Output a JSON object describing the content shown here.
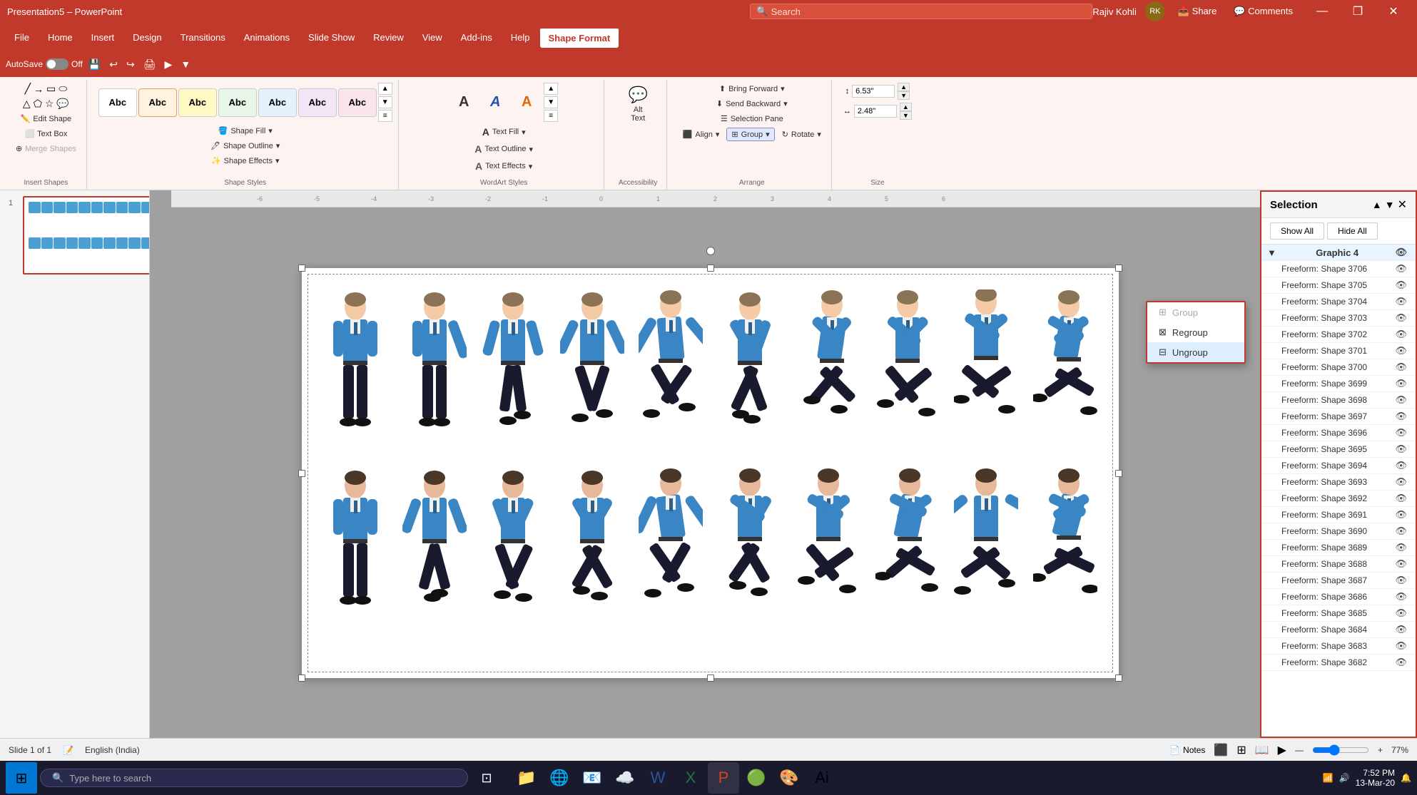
{
  "titlebar": {
    "filename": "Presentation5 – PowerPoint",
    "search_placeholder": "Search",
    "username": "Rajiv Kohli",
    "minimize": "—",
    "restore": "❐",
    "close": "✕"
  },
  "menu": {
    "items": [
      "File",
      "Home",
      "Insert",
      "Design",
      "Transitions",
      "Animations",
      "Slide Show",
      "Review",
      "View",
      "Add-ins",
      "Help",
      "Shape Format"
    ],
    "active": "Shape Format"
  },
  "quickaccess": {
    "autosave_label": "AutoSave",
    "off_label": "Off"
  },
  "ribbon": {
    "insert_shapes_label": "Insert Shapes",
    "shape_styles_label": "Shape Styles",
    "wordart_label": "WordArt Styles",
    "accessibility_label": "Accessibility",
    "arrange_label": "Arrange",
    "size_label": "Size",
    "edit_shape": "Edit Shape",
    "text_box": "Text Box",
    "merge_shapes": "Merge Shapes",
    "shape_fill": "Shape Fill",
    "shape_outline": "Shape Outline",
    "shape_effects": "Shape Effects",
    "text_fill": "Text Fill",
    "text_outline": "Text Outline",
    "text_effects": "Text Effects",
    "alt_text": "Alt\nText",
    "bring_forward": "Bring Forward",
    "send_backward": "Send Backward",
    "selection_pane": "Selection Pane",
    "align": "Align",
    "group": "Group",
    "rotate": "Rotate",
    "width": "6.53\"",
    "height": "2.48\"",
    "shape_styles": [
      {
        "bg": "#ffffff",
        "border": "#ccc",
        "text_color": "#333"
      },
      {
        "bg": "#ffe0b2",
        "border": "#ccc",
        "text_color": "#333"
      },
      {
        "bg": "#fff9c4",
        "border": "#ccc",
        "text_color": "#333"
      },
      {
        "bg": "#c8e6c9",
        "border": "#ccc",
        "text_color": "#333"
      },
      {
        "bg": "#bbdefb",
        "border": "#ccc",
        "text_color": "#333"
      },
      {
        "bg": "#e1bee7",
        "border": "#ccc",
        "text_color": "#333"
      },
      {
        "bg": "#f8bbd0",
        "border": "#ccc",
        "text_color": "#333"
      }
    ]
  },
  "group_dropdown": {
    "group_label": "Group",
    "regroup_label": "Regroup",
    "ungroup_label": "Ungroup"
  },
  "selection_pane": {
    "title": "Selection",
    "show_all": "Show All",
    "hide_all": "Hide All",
    "items": [
      {
        "name": "Graphic 4",
        "is_group": true
      },
      {
        "name": "Freeform: Shape 3706",
        "is_group": false
      },
      {
        "name": "Freeform: Shape 3705",
        "is_group": false
      },
      {
        "name": "Freeform: Shape 3704",
        "is_group": false
      },
      {
        "name": "Freeform: Shape 3703",
        "is_group": false
      },
      {
        "name": "Freeform: Shape 3702",
        "is_group": false
      },
      {
        "name": "Freeform: Shape 3701",
        "is_group": false
      },
      {
        "name": "Freeform: Shape 3700",
        "is_group": false
      },
      {
        "name": "Freeform: Shape 3699",
        "is_group": false
      },
      {
        "name": "Freeform: Shape 3698",
        "is_group": false
      },
      {
        "name": "Freeform: Shape 3697",
        "is_group": false
      },
      {
        "name": "Freeform: Shape 3696",
        "is_group": false
      },
      {
        "name": "Freeform: Shape 3695",
        "is_group": false
      },
      {
        "name": "Freeform: Shape 3694",
        "is_group": false
      },
      {
        "name": "Freeform: Shape 3693",
        "is_group": false
      },
      {
        "name": "Freeform: Shape 3692",
        "is_group": false
      },
      {
        "name": "Freeform: Shape 3691",
        "is_group": false
      },
      {
        "name": "Freeform: Shape 3690",
        "is_group": false
      },
      {
        "name": "Freeform: Shape 3689",
        "is_group": false
      },
      {
        "name": "Freeform: Shape 3688",
        "is_group": false
      },
      {
        "name": "Freeform: Shape 3687",
        "is_group": false
      },
      {
        "name": "Freeform: Shape 3686",
        "is_group": false
      },
      {
        "name": "Freeform: Shape 3685",
        "is_group": false
      },
      {
        "name": "Freeform: Shape 3684",
        "is_group": false
      },
      {
        "name": "Freeform: Shape 3683",
        "is_group": false
      },
      {
        "name": "Freeform: Shape 3682",
        "is_group": false
      }
    ]
  },
  "slide": {
    "number": "1"
  },
  "statusbar": {
    "slide_info": "Slide 1 of 1",
    "language": "English (India)",
    "notes": "Notes",
    "zoom": "77%"
  },
  "taskbar": {
    "search_placeholder": "Type here to search",
    "time": "7:52 PM",
    "date": "13-Mar-20"
  }
}
